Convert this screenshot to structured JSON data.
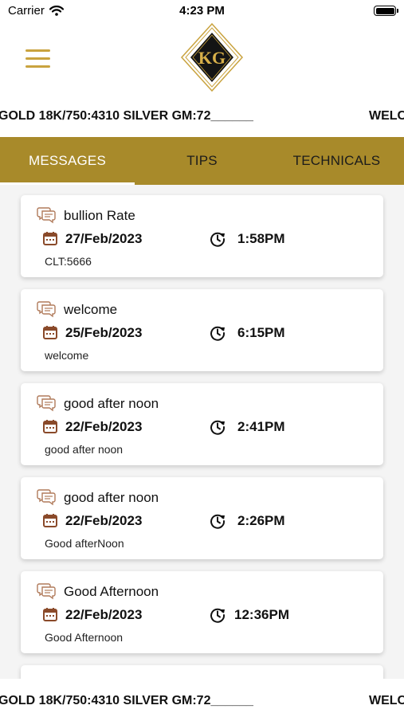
{
  "status_bar": {
    "carrier": "Carrier",
    "time": "4:23 PM"
  },
  "header": {
    "logo_text": "KG"
  },
  "ticker": {
    "text": "GOLD 18K/750:4310 SILVER GM:72______",
    "continuation": "WELC"
  },
  "tabs": [
    {
      "label": "MESSAGES",
      "active": true
    },
    {
      "label": "TIPS",
      "active": false
    },
    {
      "label": "TECHNICALS",
      "active": false
    }
  ],
  "messages": [
    {
      "title": "bullion Rate",
      "date": "27/Feb/2023",
      "time": "1:58PM",
      "body": "CLT:5666"
    },
    {
      "title": "welcome",
      "date": "25/Feb/2023",
      "time": "6:15PM",
      "body": "welcome"
    },
    {
      "title": "good after noon",
      "date": "22/Feb/2023",
      "time": "2:41PM",
      "body": "good after noon"
    },
    {
      "title": "good after noon",
      "date": "22/Feb/2023",
      "time": "2:26PM",
      "body": "Good afterNoon"
    },
    {
      "title": "Good Afternoon",
      "date": "22/Feb/2023",
      "time": "12:36PM",
      "body": "Good Afternoon"
    }
  ],
  "colors": {
    "gold": "#a88a2a",
    "menu_gold": "#c9a33f",
    "icon_brown": "#8a4a2a"
  }
}
